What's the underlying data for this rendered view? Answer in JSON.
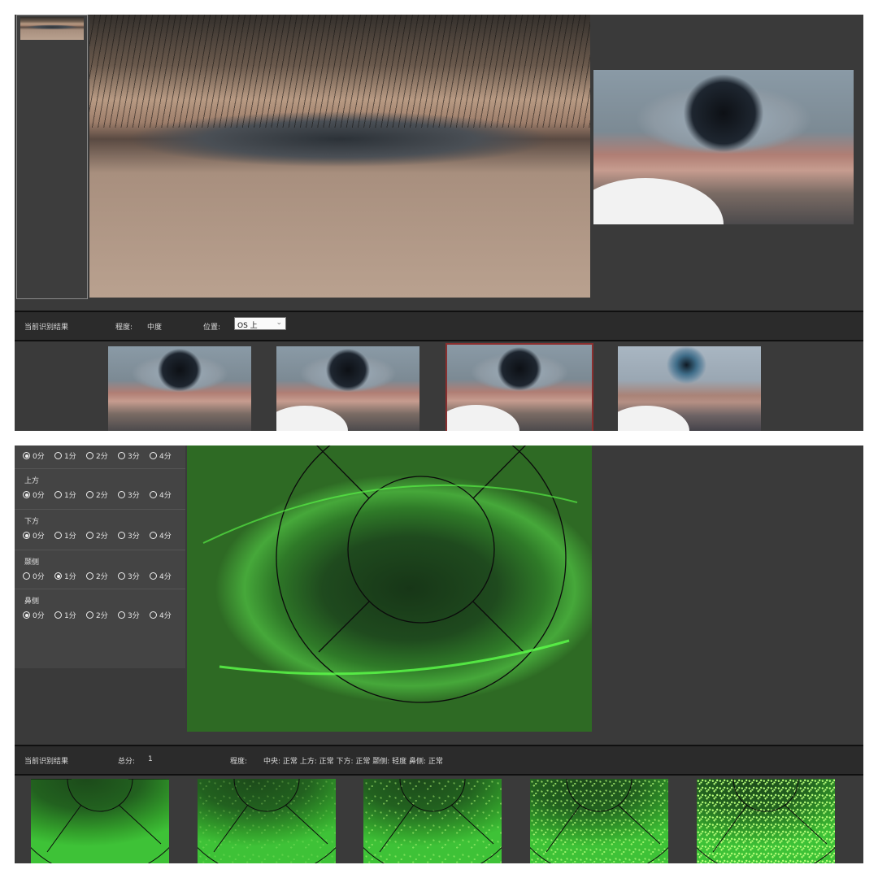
{
  "top": {
    "result_bar": {
      "current_result_label": "当前识别结果",
      "degree_label": "程度:",
      "degree_value": "中度",
      "position_label": "位置:",
      "position_select_value": "OS 上"
    }
  },
  "bottom": {
    "scores": {
      "groups": [
        {
          "label": "",
          "selected": 0
        },
        {
          "label": "上方",
          "selected": 0
        },
        {
          "label": "下方",
          "selected": 0
        },
        {
          "label": "颞侧",
          "selected": 1
        },
        {
          "label": "鼻侧",
          "selected": 0
        }
      ],
      "options": [
        "0分",
        "1分",
        "2分",
        "3分",
        "4分"
      ]
    },
    "result_bar": {
      "current_result_label": "当前识别结果",
      "total_label": "总分:",
      "total_value": "1",
      "degree_label": "程度:",
      "regions": "中央: 正常  上方: 正常  下方: 正常  颞侧: 轻度  鼻侧: 正常"
    }
  },
  "colors": {
    "panel_bg": "#3a3a3a",
    "bar_bg": "#2b2b2b",
    "selected_thumb_border": "#8a2f2f",
    "fluorescein_green": "#33a02b"
  }
}
